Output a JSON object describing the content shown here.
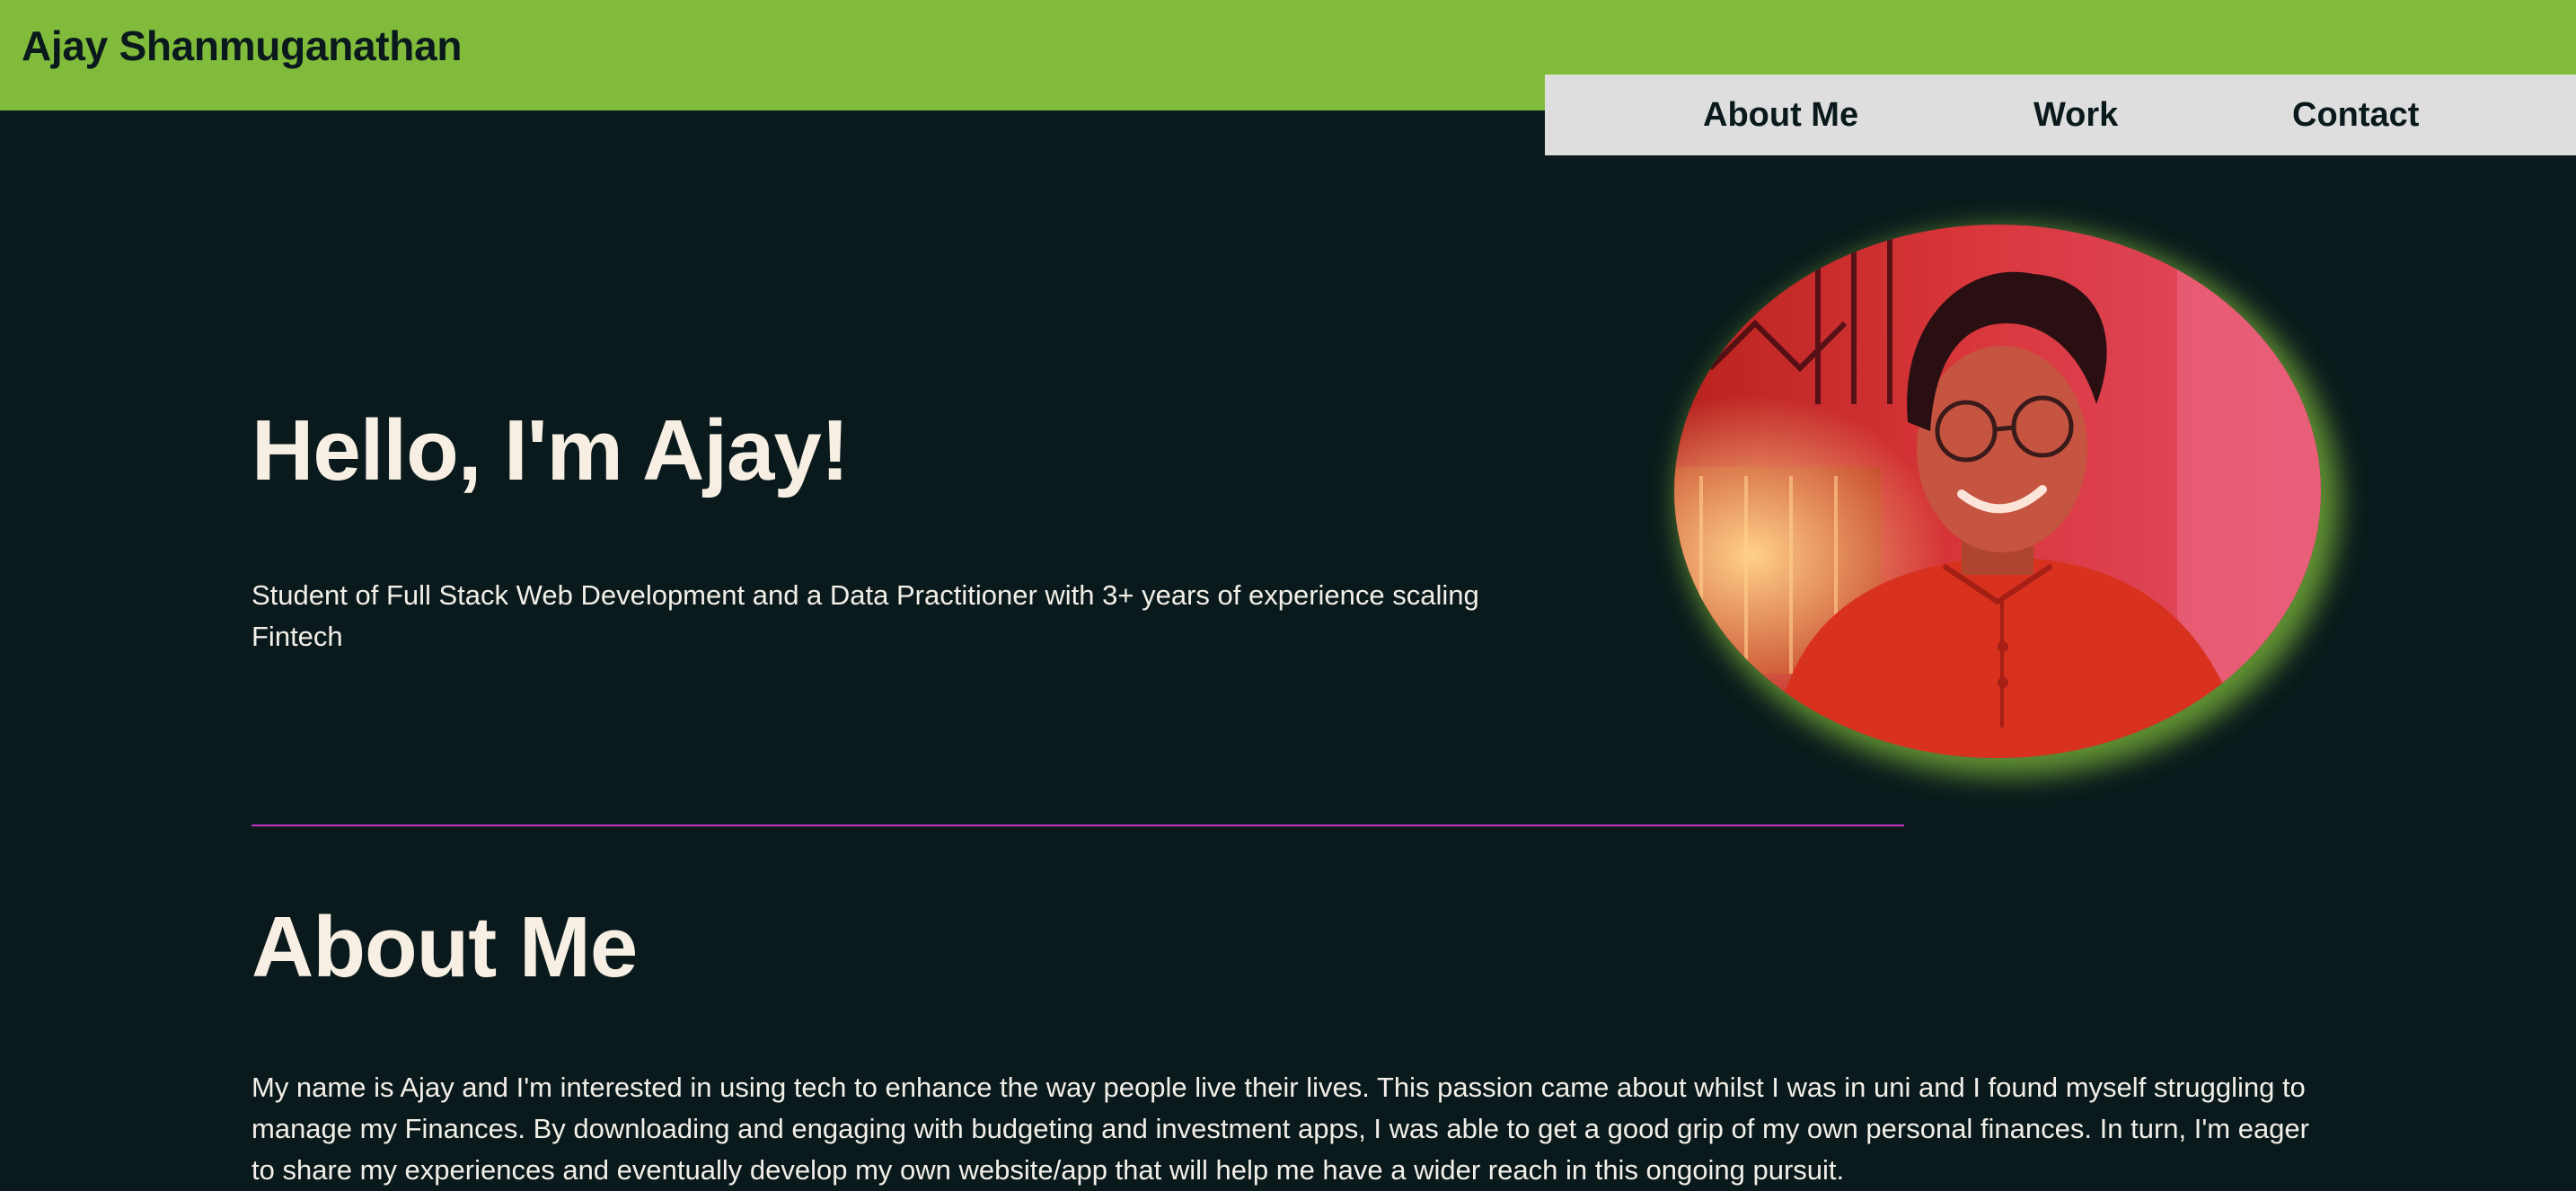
{
  "header": {
    "site_title": "Ajay Shanmuganathan",
    "nav": {
      "about": "About Me",
      "work": "Work",
      "contact": "Contact"
    }
  },
  "hero": {
    "heading": "Hello, I'm Ajay!",
    "subtitle": "Student of Full Stack Web Development and a Data Practitioner with 3+ years of experience scaling Fintech",
    "photo_icon": "portrait-photo"
  },
  "about": {
    "heading": "About Me",
    "body": "My name is Ajay and I'm interested in using tech to enhance the way people live their lives. This passion came about whilst I was in uni and I found myself struggling to manage my Finances. By downloading and engaging with budgeting and investment apps, I was able to get a good grip of my own personal finances. In turn, I'm eager to share my experiences and eventually develop my own website/app that will help me have a wider reach in this ongoing pursuit."
  },
  "colors": {
    "background": "#0a1a1c",
    "header_green": "#80bb3b",
    "nav_gray": "#dedede",
    "divider_magenta": "#c238c8",
    "heading_text": "#f7efe3"
  }
}
